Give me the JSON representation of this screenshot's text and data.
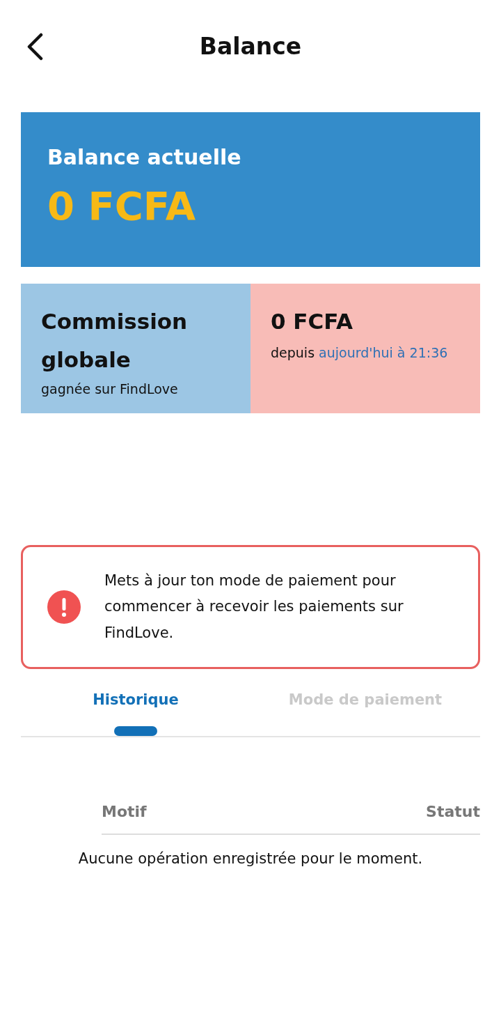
{
  "header": {
    "title": "Balance"
  },
  "balance_card": {
    "label": "Balance actuelle",
    "amount": "0 FCFA"
  },
  "commission": {
    "title": "Commission globale",
    "subtitle": "gagnée sur FindLove",
    "amount": "0 FCFA",
    "since_prefix": "depuis",
    "since_date": "aujourd'hui à 21:36"
  },
  "alert": {
    "message": "Mets à jour ton mode de paiement pour commencer à recevoir les paiements sur FindLove."
  },
  "tabs": [
    {
      "label": "Historique",
      "selected": true
    },
    {
      "label": "Mode de paiement",
      "selected": false
    }
  ],
  "table": {
    "columns": [
      "Motif",
      "Statut"
    ],
    "empty_message": "Aucune opération enregistrée pour le moment."
  }
}
